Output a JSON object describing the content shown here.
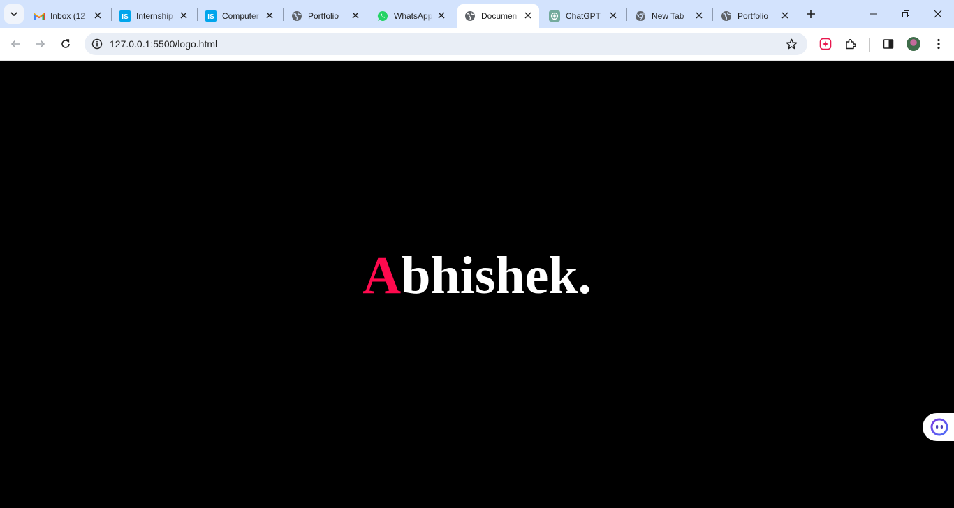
{
  "browser": {
    "tabs": [
      {
        "title": "Inbox (12",
        "favicon": "gmail-icon",
        "active": false
      },
      {
        "title": "Internship",
        "favicon": "is-icon",
        "active": false
      },
      {
        "title": "Computer",
        "favicon": "is-icon",
        "active": false
      },
      {
        "title": "Portfolio",
        "favicon": "globe-icon",
        "active": false
      },
      {
        "title": "WhatsApp",
        "favicon": "whatsapp-icon",
        "active": false
      },
      {
        "title": "Documen",
        "favicon": "globe-icon",
        "active": true
      },
      {
        "title": "ChatGPT",
        "favicon": "chatgpt-icon",
        "active": false
      },
      {
        "title": "New Tab",
        "favicon": "chrome-icon",
        "active": false
      },
      {
        "title": "Portfolio",
        "favicon": "globe-icon",
        "active": false
      }
    ],
    "address": {
      "url": "127.0.0.1:5500/logo.html"
    },
    "colors": {
      "tabstrip": "#d3e3fd",
      "toolbar": "#ffffff",
      "omnibox": "#e9eef6"
    }
  },
  "page": {
    "logo": {
      "first_letter": "A",
      "rest": "bhishek."
    },
    "colors": {
      "background": "#000000",
      "accent": "#ff0a4e",
      "text": "#ffffff"
    }
  }
}
